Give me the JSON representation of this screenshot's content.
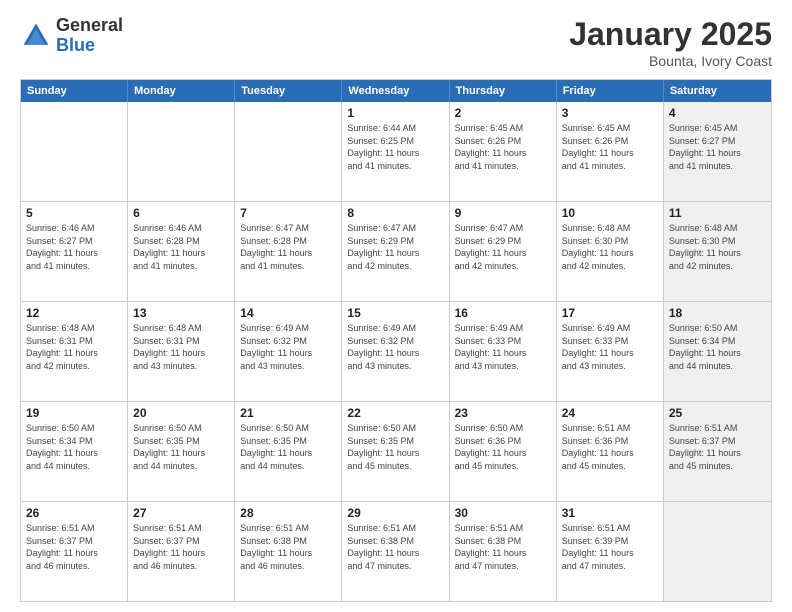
{
  "logo": {
    "general": "General",
    "blue": "Blue"
  },
  "title": {
    "month": "January 2025",
    "location": "Bounta, Ivory Coast"
  },
  "weekdays": [
    "Sunday",
    "Monday",
    "Tuesday",
    "Wednesday",
    "Thursday",
    "Friday",
    "Saturday"
  ],
  "rows": [
    [
      {
        "day": "",
        "info": "",
        "shaded": false
      },
      {
        "day": "",
        "info": "",
        "shaded": false
      },
      {
        "day": "",
        "info": "",
        "shaded": false
      },
      {
        "day": "1",
        "info": "Sunrise: 6:44 AM\nSunset: 6:25 PM\nDaylight: 11 hours\nand 41 minutes.",
        "shaded": false
      },
      {
        "day": "2",
        "info": "Sunrise: 6:45 AM\nSunset: 6:26 PM\nDaylight: 11 hours\nand 41 minutes.",
        "shaded": false
      },
      {
        "day": "3",
        "info": "Sunrise: 6:45 AM\nSunset: 6:26 PM\nDaylight: 11 hours\nand 41 minutes.",
        "shaded": false
      },
      {
        "day": "4",
        "info": "Sunrise: 6:45 AM\nSunset: 6:27 PM\nDaylight: 11 hours\nand 41 minutes.",
        "shaded": true
      }
    ],
    [
      {
        "day": "5",
        "info": "Sunrise: 6:46 AM\nSunset: 6:27 PM\nDaylight: 11 hours\nand 41 minutes.",
        "shaded": false
      },
      {
        "day": "6",
        "info": "Sunrise: 6:46 AM\nSunset: 6:28 PM\nDaylight: 11 hours\nand 41 minutes.",
        "shaded": false
      },
      {
        "day": "7",
        "info": "Sunrise: 6:47 AM\nSunset: 6:28 PM\nDaylight: 11 hours\nand 41 minutes.",
        "shaded": false
      },
      {
        "day": "8",
        "info": "Sunrise: 6:47 AM\nSunset: 6:29 PM\nDaylight: 11 hours\nand 42 minutes.",
        "shaded": false
      },
      {
        "day": "9",
        "info": "Sunrise: 6:47 AM\nSunset: 6:29 PM\nDaylight: 11 hours\nand 42 minutes.",
        "shaded": false
      },
      {
        "day": "10",
        "info": "Sunrise: 6:48 AM\nSunset: 6:30 PM\nDaylight: 11 hours\nand 42 minutes.",
        "shaded": false
      },
      {
        "day": "11",
        "info": "Sunrise: 6:48 AM\nSunset: 6:30 PM\nDaylight: 11 hours\nand 42 minutes.",
        "shaded": true
      }
    ],
    [
      {
        "day": "12",
        "info": "Sunrise: 6:48 AM\nSunset: 6:31 PM\nDaylight: 11 hours\nand 42 minutes.",
        "shaded": false
      },
      {
        "day": "13",
        "info": "Sunrise: 6:48 AM\nSunset: 6:31 PM\nDaylight: 11 hours\nand 43 minutes.",
        "shaded": false
      },
      {
        "day": "14",
        "info": "Sunrise: 6:49 AM\nSunset: 6:32 PM\nDaylight: 11 hours\nand 43 minutes.",
        "shaded": false
      },
      {
        "day": "15",
        "info": "Sunrise: 6:49 AM\nSunset: 6:32 PM\nDaylight: 11 hours\nand 43 minutes.",
        "shaded": false
      },
      {
        "day": "16",
        "info": "Sunrise: 6:49 AM\nSunset: 6:33 PM\nDaylight: 11 hours\nand 43 minutes.",
        "shaded": false
      },
      {
        "day": "17",
        "info": "Sunrise: 6:49 AM\nSunset: 6:33 PM\nDaylight: 11 hours\nand 43 minutes.",
        "shaded": false
      },
      {
        "day": "18",
        "info": "Sunrise: 6:50 AM\nSunset: 6:34 PM\nDaylight: 11 hours\nand 44 minutes.",
        "shaded": true
      }
    ],
    [
      {
        "day": "19",
        "info": "Sunrise: 6:50 AM\nSunset: 6:34 PM\nDaylight: 11 hours\nand 44 minutes.",
        "shaded": false
      },
      {
        "day": "20",
        "info": "Sunrise: 6:50 AM\nSunset: 6:35 PM\nDaylight: 11 hours\nand 44 minutes.",
        "shaded": false
      },
      {
        "day": "21",
        "info": "Sunrise: 6:50 AM\nSunset: 6:35 PM\nDaylight: 11 hours\nand 44 minutes.",
        "shaded": false
      },
      {
        "day": "22",
        "info": "Sunrise: 6:50 AM\nSunset: 6:35 PM\nDaylight: 11 hours\nand 45 minutes.",
        "shaded": false
      },
      {
        "day": "23",
        "info": "Sunrise: 6:50 AM\nSunset: 6:36 PM\nDaylight: 11 hours\nand 45 minutes.",
        "shaded": false
      },
      {
        "day": "24",
        "info": "Sunrise: 6:51 AM\nSunset: 6:36 PM\nDaylight: 11 hours\nand 45 minutes.",
        "shaded": false
      },
      {
        "day": "25",
        "info": "Sunrise: 6:51 AM\nSunset: 6:37 PM\nDaylight: 11 hours\nand 45 minutes.",
        "shaded": true
      }
    ],
    [
      {
        "day": "26",
        "info": "Sunrise: 6:51 AM\nSunset: 6:37 PM\nDaylight: 11 hours\nand 46 minutes.",
        "shaded": false
      },
      {
        "day": "27",
        "info": "Sunrise: 6:51 AM\nSunset: 6:37 PM\nDaylight: 11 hours\nand 46 minutes.",
        "shaded": false
      },
      {
        "day": "28",
        "info": "Sunrise: 6:51 AM\nSunset: 6:38 PM\nDaylight: 11 hours\nand 46 minutes.",
        "shaded": false
      },
      {
        "day": "29",
        "info": "Sunrise: 6:51 AM\nSunset: 6:38 PM\nDaylight: 11 hours\nand 47 minutes.",
        "shaded": false
      },
      {
        "day": "30",
        "info": "Sunrise: 6:51 AM\nSunset: 6:38 PM\nDaylight: 11 hours\nand 47 minutes.",
        "shaded": false
      },
      {
        "day": "31",
        "info": "Sunrise: 6:51 AM\nSunset: 6:39 PM\nDaylight: 11 hours\nand 47 minutes.",
        "shaded": false
      },
      {
        "day": "",
        "info": "",
        "shaded": true
      }
    ]
  ]
}
